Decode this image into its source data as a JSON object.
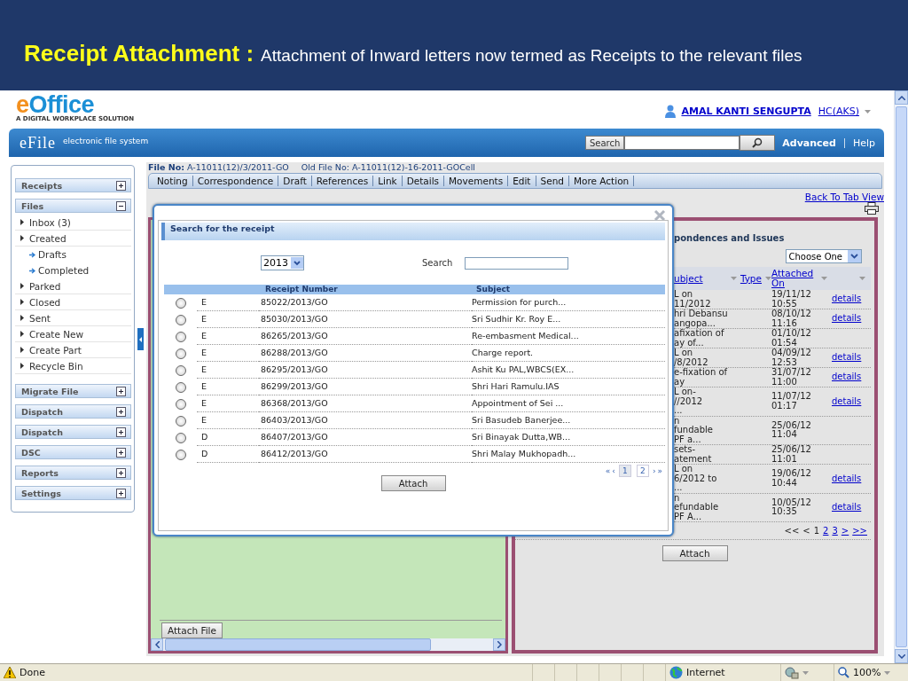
{
  "slide_title": {
    "lead": "Receipt Attachment :",
    "text": "Attachment of Inward letters now termed as Receipts to the relevant files"
  },
  "header": {
    "logo": {
      "accent": "e",
      "rest": "Office",
      "tagline": "A DIGITAL WORKPLACE SOLUTION"
    },
    "user": {
      "name": "AMAL KANTI SENGUPTA",
      "role": "HC(AKS)"
    }
  },
  "app_bar": {
    "title": "eFile",
    "subtitle": "electronic file system",
    "search_label": "Search",
    "links": [
      "Advanced",
      "Help"
    ]
  },
  "sidebar": [
    {
      "label": "Receipts",
      "expanded": false
    },
    {
      "label": "Files",
      "expanded": true,
      "items": [
        {
          "label": "Inbox (3)"
        },
        {
          "label": "Created",
          "children": [
            {
              "label": "Drafts"
            },
            {
              "label": "Completed"
            }
          ]
        },
        {
          "label": "Parked"
        },
        {
          "label": "Closed"
        },
        {
          "label": "Sent"
        },
        {
          "label": "Create New"
        },
        {
          "label": "Create Part"
        },
        {
          "label": "Recycle Bin"
        }
      ]
    },
    {
      "label": "Migrate File",
      "expanded": false
    },
    {
      "label": "Dispatch",
      "expanded": false
    },
    {
      "label": "Dispatch",
      "expanded": false
    },
    {
      "label": "DSC",
      "expanded": false
    },
    {
      "label": "Reports",
      "expanded": false
    },
    {
      "label": "Settings",
      "expanded": false
    }
  ],
  "file_view": {
    "file_no_label": "File No:",
    "file_no": "A-11011(12)/3/2011-GO",
    "old_file_no_label": "Old File No:",
    "old_file_no": "A-11011(12)-16-2011-GOCell",
    "tabs": [
      "Noting",
      "Correspondence",
      "Draft",
      "References",
      "Link",
      "Details",
      "Movements",
      "Edit",
      "Send",
      "More Action"
    ],
    "back_link": "Back To Tab View",
    "attach_file_button": "Attach File",
    "correspondence": {
      "heading": "pondences and Issues",
      "filter": "Choose One",
      "columns": [
        "ubject",
        "Type",
        "Attached On"
      ],
      "rows": [
        {
          "subject": "L on\n11/2012",
          "attached_on": "19/11/12\n10:55",
          "link": "details"
        },
        {
          "subject": "hri Debansu\nangopa...",
          "attached_on": "08/10/12\n11:16",
          "link": "details"
        },
        {
          "subject": "afixation of\nay of...",
          "attached_on": "01/10/12\n01:54"
        },
        {
          "subject": "L on\n/8/2012",
          "attached_on": "04/09/12\n12:53",
          "link": "details"
        },
        {
          "subject": "e-fixation of\nay",
          "attached_on": "31/07/12\n11:00",
          "link": "details"
        },
        {
          "subject": "L on-\n//2012\n...",
          "attached_on": "11/07/12\n01:17",
          "link": "details"
        },
        {
          "subject": "n\nfundable\nPF a...",
          "attached_on": "25/06/12\n11:04"
        },
        {
          "subject": "sets-\natement",
          "attached_on": "25/06/12\n11:01"
        },
        {
          "subject": "L on\n6/2012 to\n...",
          "attached_on": "19/06/12\n10:44",
          "link": "details"
        },
        {
          "subject": "n\nefundable\nPF A...",
          "attached_on": "10/05/12\n10:35",
          "link": "details"
        }
      ],
      "pager": [
        {
          "label": "<<",
          "link": false
        },
        {
          "label": "<",
          "link": false
        },
        {
          "label": "1",
          "link": false
        },
        {
          "label": "2",
          "link": true
        },
        {
          "label": "3",
          "link": true
        },
        {
          "label": ">",
          "link": true
        },
        {
          "label": ">>",
          "link": true
        }
      ],
      "attach_button": "Attach"
    }
  },
  "dialog": {
    "title": "Search for the receipt",
    "year": "2013",
    "search_label": "Search",
    "columns": [
      "Receipt Number",
      "Subject"
    ],
    "rows": [
      {
        "type": "E",
        "number": "85022/2013/GO",
        "subject": "Permission for purch...",
        "selected": false
      },
      {
        "type": "E",
        "number": "85030/2013/GO",
        "subject": "Sri Sudhir Kr. Roy E...",
        "selected": false
      },
      {
        "type": "E",
        "number": "86265/2013/GO",
        "subject": "Re-embasment Medical...",
        "selected": false
      },
      {
        "type": "E",
        "number": "86288/2013/GO",
        "subject": "Charge report.",
        "selected": false
      },
      {
        "type": "E",
        "number": "86295/2013/GO",
        "subject": "Ashit Ku PAL,WBCS(EX...",
        "selected": false
      },
      {
        "type": "E",
        "number": "86299/2013/GO",
        "subject": "Shri Hari Ramulu.IAS",
        "selected": false
      },
      {
        "type": "E",
        "number": "86368/2013/GO",
        "subject": "Appointment of Sei ...",
        "selected": false
      },
      {
        "type": "E",
        "number": "86403/2013/GO",
        "subject": "Sri Basudeb Banerjee...",
        "selected": false
      },
      {
        "type": "D",
        "number": "86407/2013/GO",
        "subject": "Sri Binayak Dutta,WB...",
        "selected": false
      },
      {
        "type": "D",
        "number": "86412/2013/GO",
        "subject": "Shri Malay Mukhopadh...",
        "selected": false
      }
    ],
    "pager": {
      "arrows_before": [
        "«",
        "‹"
      ],
      "pages": [
        {
          "label": "1",
          "selected": true
        },
        {
          "label": "2",
          "selected": false
        }
      ],
      "arrows_after": [
        "›",
        "»"
      ]
    },
    "attach_button": "Attach"
  },
  "status_bar": {
    "status": "Done",
    "zone": "Internet",
    "zoom": "100%"
  }
}
